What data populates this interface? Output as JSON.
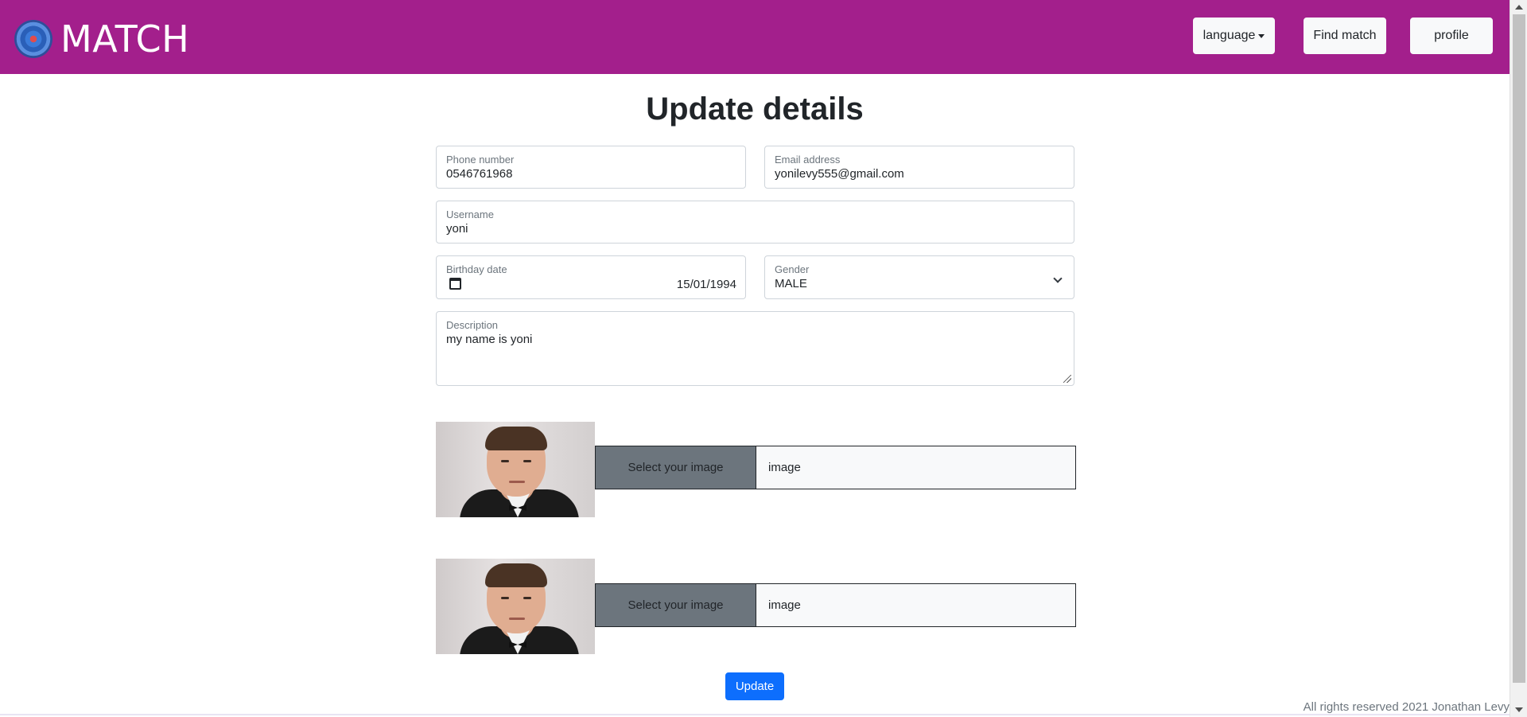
{
  "header": {
    "brand": "MATCH",
    "language_label": "language",
    "find_match_label": "Find match",
    "profile_label": "profile"
  },
  "page": {
    "title": "Update details"
  },
  "form": {
    "phone": {
      "label": "Phone number",
      "value": "0546761968"
    },
    "email": {
      "label": "Email address",
      "value": "yonilevy555@gmail.com"
    },
    "username": {
      "label": "Username",
      "value": "yoni"
    },
    "birthday": {
      "label": "Birthday date",
      "value": "15/01/1994"
    },
    "gender": {
      "label": "Gender",
      "value": "MALE"
    },
    "description": {
      "label": "Description",
      "value": "my name is yoni"
    }
  },
  "images": [
    {
      "select_label": "Select your image",
      "file_name": "image"
    },
    {
      "select_label": "Select your image",
      "file_name": "image"
    }
  ],
  "actions": {
    "update_label": "Update"
  },
  "footer": {
    "text": "All rights reserved 2021 Jonathan Levy"
  },
  "colors": {
    "brand": "#a31f8c",
    "primary": "#0d6efd",
    "secondary": "#6c757d"
  }
}
